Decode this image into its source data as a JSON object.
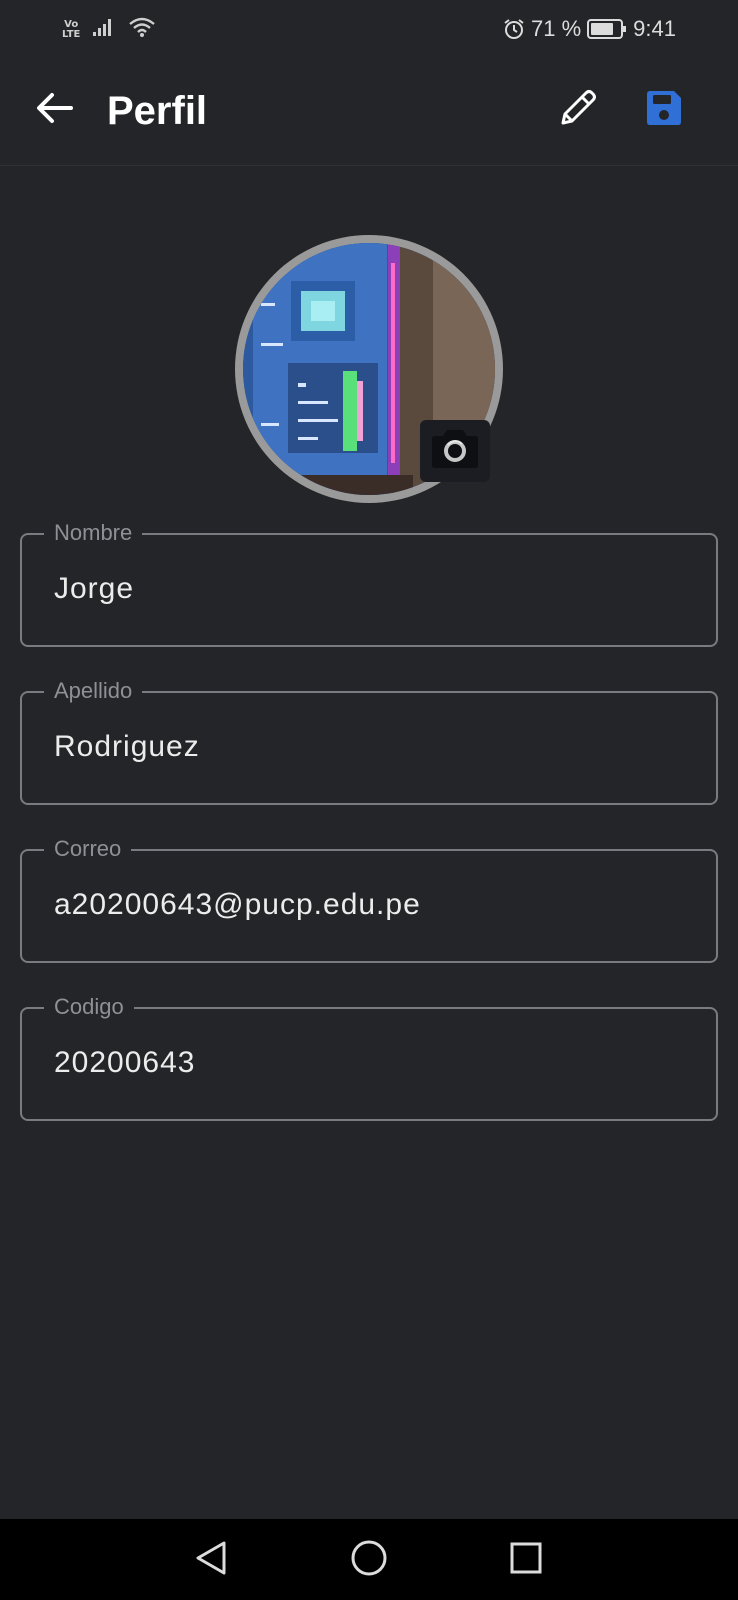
{
  "status_bar": {
    "network_label_top": "Vo",
    "network_label_bottom": "LTE",
    "battery_percent": "71 %",
    "time": "9:41",
    "icons": [
      "signal-icon",
      "wifi-icon",
      "alarm-icon",
      "battery-icon"
    ]
  },
  "app_bar": {
    "title": "Perfil",
    "accent_color": "#2f6fd6"
  },
  "avatar": {
    "icon": "camera-icon"
  },
  "fields": [
    {
      "label": "Nombre",
      "value": "Jorge"
    },
    {
      "label": "Apellido",
      "value": "Rodriguez"
    },
    {
      "label": "Correo",
      "value": "a20200643@pucp.edu.pe"
    },
    {
      "label": "Codigo",
      "value": "20200643"
    }
  ],
  "nav_bar": {
    "icons": [
      "back-triangle-icon",
      "home-circle-icon",
      "recents-square-icon"
    ]
  }
}
